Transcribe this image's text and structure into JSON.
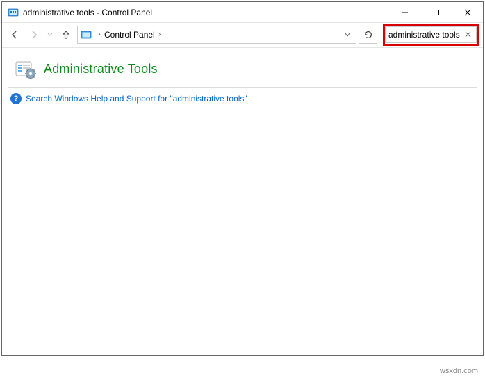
{
  "window": {
    "title": "administrative tools - Control Panel"
  },
  "address": {
    "location": "Control Panel"
  },
  "search": {
    "value": "administrative tools"
  },
  "content": {
    "result_title": "Administrative Tools",
    "help_text": "Search Windows Help and Support for \"administrative tools\""
  },
  "footer": {
    "attribution": "wsxdn.com"
  }
}
